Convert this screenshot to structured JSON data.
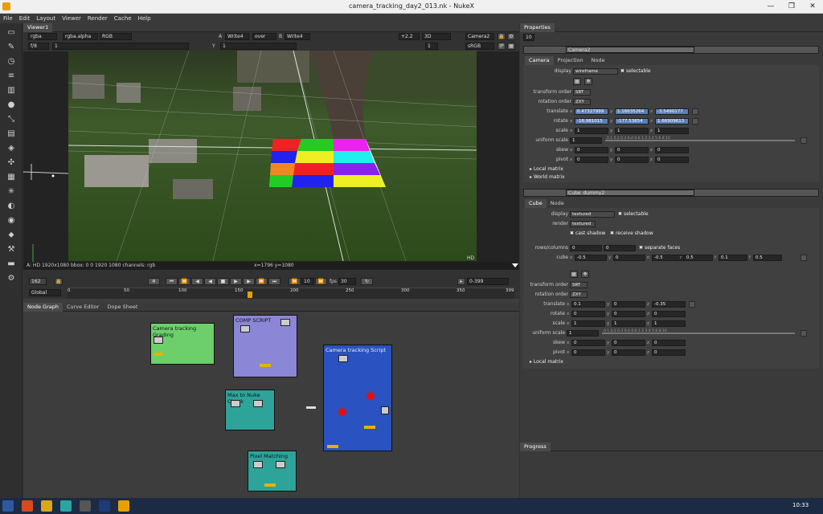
{
  "window": {
    "title": "camera_tracking_day2_013.nk - NukeX"
  },
  "menu": [
    "File",
    "Edit",
    "Layout",
    "Viewer",
    "Render",
    "Cache",
    "Help"
  ],
  "viewer": {
    "tab": "Viewer1",
    "channels": "rgba",
    "alpha": "rgba.alpha",
    "display_channels": "RGB",
    "a_input": "Write4",
    "a_label": "A",
    "op": "over",
    "b_label": "B",
    "b_input": "Write4",
    "gain": "+2.2",
    "view_mode": "3D",
    "camera": "Camera2",
    "lut": "sRGB",
    "fstop": "f/8",
    "frame_gain": "1",
    "y_label": "Y",
    "y_value": "1",
    "proxy": "1",
    "info": "A: HD 1920x1080 bbox: 0 0 1920 1080 channels: rgb",
    "coords": "x=1796 y=1080",
    "format": "HD",
    "frame": "162",
    "step": "10",
    "fps_label": "fps",
    "fps": "30",
    "range": "0-399",
    "global": "Global",
    "ruler": [
      "0",
      "50",
      "100",
      "150",
      "200",
      "250",
      "300",
      "350",
      "399"
    ],
    "ruler_end": "399"
  },
  "nodegraph": {
    "tabs": [
      "Node Graph",
      "Curve Editor",
      "Dope Sheet"
    ],
    "backdrops": [
      {
        "label": "Camera tracking Grading",
        "color": "#6ccf6c"
      },
      {
        "label": "COMP SCRIPT",
        "color": "#8b86d6"
      },
      {
        "label": "Max to Nuke Check",
        "color": "#2ea39a"
      },
      {
        "label": "Camera tracking Script",
        "color": "#2a52c0"
      },
      {
        "label": "Pixel Matching",
        "color": "#2ea39a"
      }
    ]
  },
  "properties": {
    "tab": "Properties",
    "max_panels": "10",
    "camera": {
      "name": "Camera2",
      "tabs": [
        "Camera",
        "Projection",
        "Node"
      ],
      "display_label": "display",
      "display": "wireframe",
      "selectable": "selectable",
      "transform_order_label": "transform order",
      "transform_order": "SRT",
      "rotation_order_label": "rotation order",
      "rotation_order": "ZXY",
      "translate_label": "translate",
      "translate": [
        "0.47327999",
        "1.16635264",
        "-3.5490177"
      ],
      "rotate_label": "rotate",
      "rotate": [
        "-16.981015",
        "-177.53654",
        "1.66909613"
      ],
      "scale_label": "scale",
      "scale": [
        "1",
        "1",
        "1"
      ],
      "uniform_scale_label": "uniform scale",
      "uniform_scale": "1",
      "skew_label": "skew",
      "skew": [
        "0",
        "0",
        "0"
      ],
      "pivot_label": "pivot",
      "pivot": [
        "0",
        "0",
        "0"
      ],
      "local_matrix": "Local matrix",
      "world_matrix": "World matrix",
      "slider_ticks": "0.1   0.2 0.3 0.4  0.6  1       2        3        4        5  6    8  10"
    },
    "cube": {
      "name": "Cube_dummy2",
      "tabs": [
        "Cube",
        "Node"
      ],
      "display_label": "display",
      "display": "textured",
      "selectable": "selectable",
      "render_label": "render",
      "render": "textured",
      "cast_shadow": "cast shadow",
      "receive_shadow": "receive shadow",
      "rows_label": "rows/columns",
      "rows": "0",
      "columns": "0",
      "separate_faces": "separate faces",
      "cube_label": "cube",
      "cube": [
        "-0.5",
        "0",
        "-0.5",
        "0.5",
        "0.1",
        "0.5"
      ],
      "cube_axes": [
        "x",
        "y",
        "n",
        "r",
        "t",
        "f"
      ],
      "transform_order_label": "transform order",
      "transform_order": "SRT",
      "rotation_order_label": "rotation order",
      "rotation_order": "ZXY",
      "translate_label": "translate",
      "translate": [
        "0.1",
        "0",
        "-0.35"
      ],
      "rotate_label": "rotate",
      "rotate": [
        "0",
        "0",
        "0"
      ],
      "scale_label": "scale",
      "scale": [
        "1",
        "1",
        "1"
      ],
      "uniform_scale_label": "uniform scale",
      "uniform_scale": "1",
      "skew_label": "skew",
      "skew": [
        "0",
        "0",
        "0"
      ],
      "pivot_label": "pivot",
      "pivot": [
        "0",
        "0",
        "0"
      ],
      "local_matrix": "Local matrix",
      "slider_ticks": "0.1   0.2 0.3 0.4  0.6  1       2        3        4        5  6    8  10"
    },
    "progress": "Progress"
  },
  "taskbar": {
    "time": "10:33"
  }
}
